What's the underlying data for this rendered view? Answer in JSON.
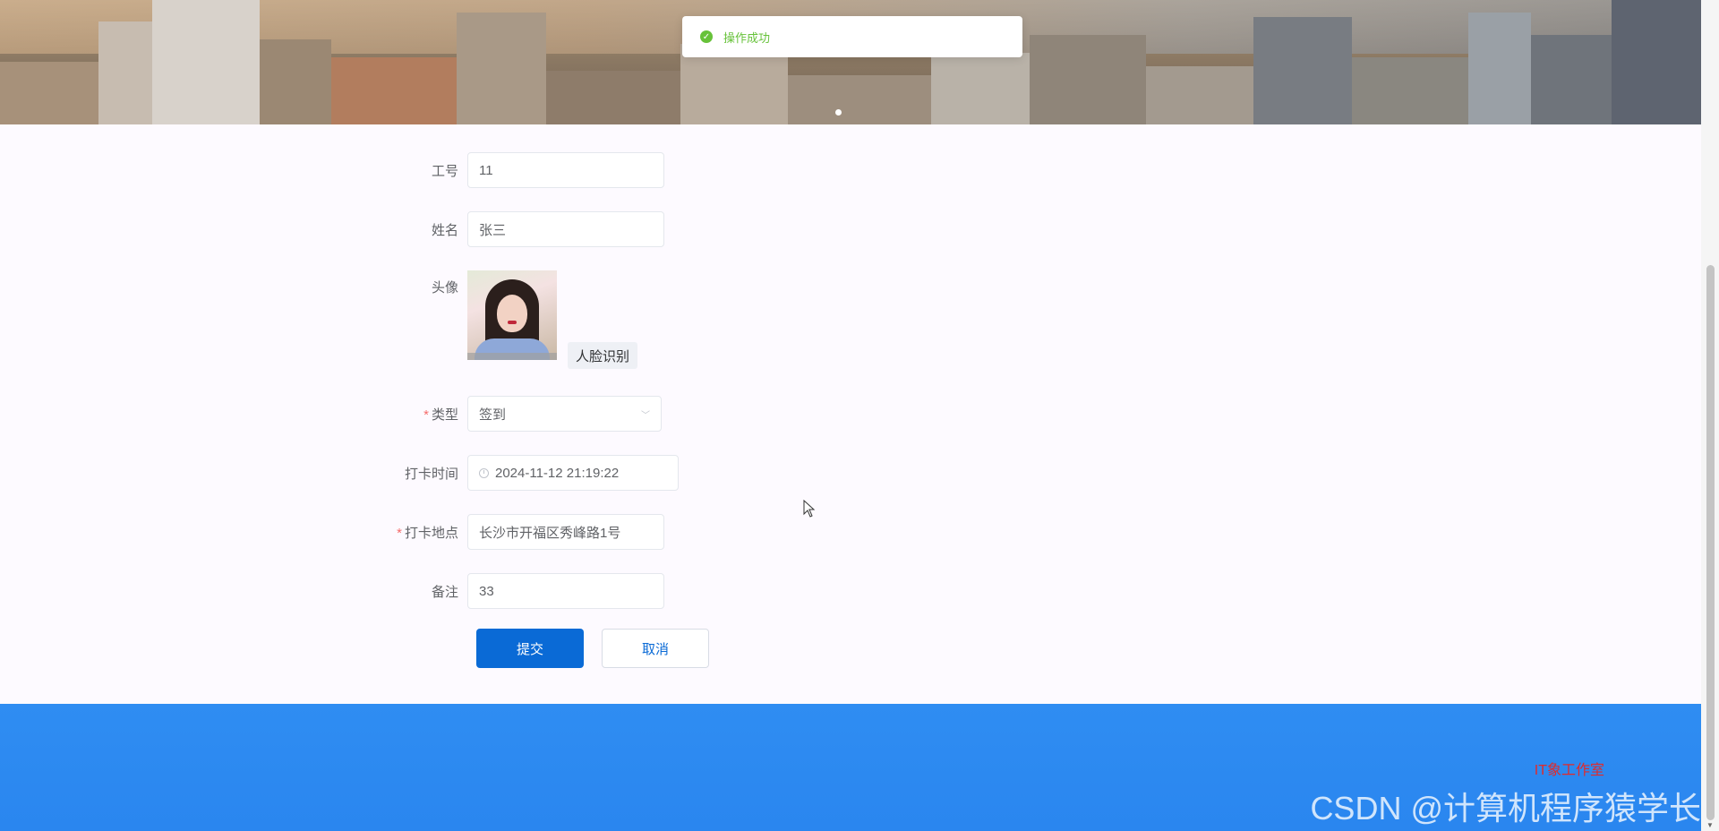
{
  "toast": {
    "message": "操作成功",
    "status_color": "#67c23a"
  },
  "form": {
    "employee_id": {
      "label": "工号",
      "value": "11"
    },
    "name": {
      "label": "姓名",
      "value": "张三"
    },
    "avatar": {
      "label": "头像",
      "face_button": "人脸识别"
    },
    "type": {
      "label": "类型",
      "required": "*",
      "value": "签到"
    },
    "punch_time": {
      "label": "打卡时间",
      "value": "2024-11-12 21:19:22"
    },
    "punch_location": {
      "label": "打卡地点",
      "required": "*",
      "value": "长沙市开福区秀峰路1号"
    },
    "remark": {
      "label": "备注",
      "value": "33"
    },
    "submit_label": "提交",
    "cancel_label": "取消"
  },
  "footer": {
    "studio_text": "IT象工作室",
    "watermark": "CSDN @计算机程序猿学长"
  },
  "colors": {
    "primary": "#0a6ad6",
    "footer_bg": "#2f8df2",
    "required": "#f56c6c"
  },
  "icons": [
    "check-circle-icon",
    "chevron-down-icon",
    "clock-icon",
    "mouse-cursor-icon"
  ]
}
